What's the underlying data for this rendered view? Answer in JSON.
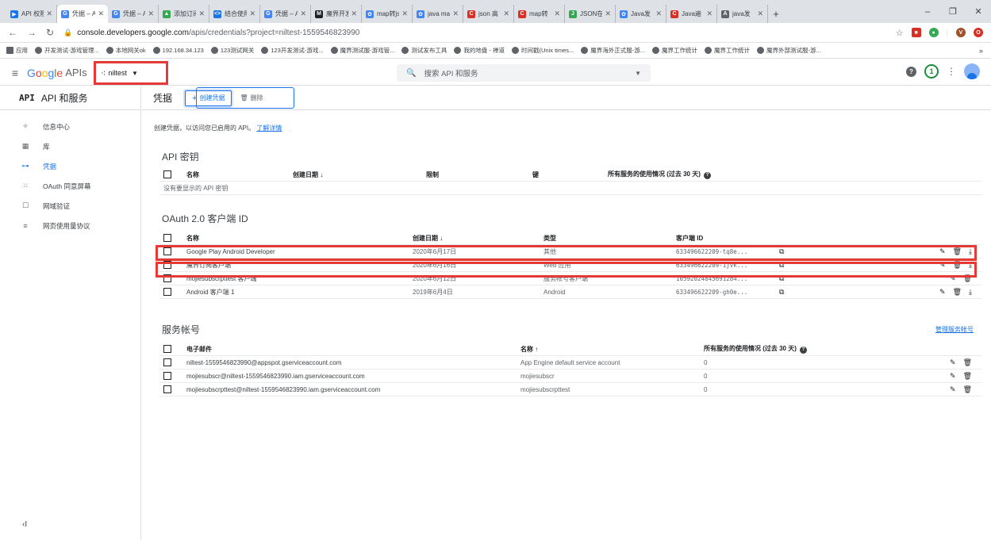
{
  "browser": {
    "tabs": [
      {
        "title": "API 权限",
        "color": "#1a73e8",
        "glyph": "▶"
      },
      {
        "title": "凭据 – A",
        "color": "#4285f4",
        "glyph": "G",
        "active": true
      },
      {
        "title": "凭据 – A",
        "color": "#4285f4",
        "glyph": "G"
      },
      {
        "title": "添加订阅",
        "color": "#34a853",
        "glyph": "▲"
      },
      {
        "title": "结合使用",
        "color": "#1a73e8",
        "glyph": "<>"
      },
      {
        "title": "凭据 – A",
        "color": "#4285f4",
        "glyph": "G"
      },
      {
        "title": "魔界开发",
        "color": "#202124",
        "glyph": "M"
      },
      {
        "title": "map转js",
        "color": "#4285f4",
        "glyph": "✿"
      },
      {
        "title": "java ma",
        "color": "#4285f4",
        "glyph": "✿"
      },
      {
        "title": "json 高",
        "color": "#d93025",
        "glyph": "C"
      },
      {
        "title": "map转",
        "color": "#d93025",
        "glyph": "C"
      },
      {
        "title": "JSON在",
        "color": "#34a853",
        "glyph": "J"
      },
      {
        "title": "Java发",
        "color": "#4285f4",
        "glyph": "✿"
      },
      {
        "title": "Java遍",
        "color": "#d93025",
        "glyph": "C"
      },
      {
        "title": "java发",
        "color": "#5f6368",
        "glyph": "A"
      }
    ],
    "new_tab": "+",
    "window_controls": {
      "minimize": "–",
      "maximize": "❐",
      "close": "✕"
    },
    "url": {
      "host": "console.developers.google.com",
      "path": "/apis/credentials?project=niltest-1559546823990"
    },
    "bookmarks": [
      {
        "label": "应用"
      },
      {
        "label": "开发测试-游戏管理..."
      },
      {
        "label": "本地网关ok"
      },
      {
        "label": "192.168.34.123"
      },
      {
        "label": "123测试网关"
      },
      {
        "label": "123开发测试-游戏..."
      },
      {
        "label": "魔界测试服-游戏管..."
      },
      {
        "label": "测试发布工具"
      },
      {
        "label": "我的地盘 - 禅道"
      },
      {
        "label": "时间戳(Unix times..."
      },
      {
        "label": "魔界海外正式服-游..."
      },
      {
        "label": "魔界工作统计"
      },
      {
        "label": "魔界工作统计"
      },
      {
        "label": "魔界外部测试服-游..."
      }
    ],
    "bookmarks_more": "»"
  },
  "header": {
    "logo_parts": [
      "G",
      "o",
      "o",
      "g",
      "l",
      "e"
    ],
    "logo_apis": "APIs",
    "project": "niltest",
    "search_placeholder": "搜索 API 和服务",
    "notifications": "1"
  },
  "sidebar": {
    "title_code": "API",
    "title": "API 和服务",
    "items": [
      {
        "label": "信息中心",
        "icon": "✧"
      },
      {
        "label": "库",
        "icon": "▦"
      },
      {
        "label": "凭据",
        "icon": "⊶",
        "active": true
      },
      {
        "label": "OAuth 同意屏幕",
        "icon": "⁙"
      },
      {
        "label": "网域验证",
        "icon": "☐"
      },
      {
        "label": "网页使用量协议",
        "icon": "≡"
      }
    ],
    "collapse": "‹I"
  },
  "main": {
    "title": "凭据",
    "create_btn": "创建凭据",
    "delete_btn": "删除",
    "intro": "创建凭据，以访问您已启用的 API。",
    "learn_more": "了解详情",
    "api_keys": {
      "title": "API 密钥",
      "headers": [
        "名称",
        "创建日期 ↓",
        "限制",
        "键",
        "所有服务的使用情况 (过去 30 天)"
      ],
      "empty": "没有要显示的 API 密钥"
    },
    "oauth": {
      "title": "OAuth 2.0 客户端 ID",
      "headers": [
        "名称",
        "创建日期 ↓",
        "类型",
        "客户端 ID"
      ],
      "rows": [
        {
          "name": "Google Play Android Developer",
          "date": "2020年6月17日",
          "type": "其他",
          "client_id": "633496622209-tq8e..."
        },
        {
          "name": "魔界订阅客户端",
          "date": "2020年6月16日",
          "type": "Web 应用",
          "client_id": "633496622209-1jvk..."
        },
        {
          "name": "mojiesubscrpttest 客户端",
          "date": "2020年6月12日",
          "type": "服务帐号客户端",
          "client_id": "10592024845691284..."
        },
        {
          "name": "Android 客户端 1",
          "date": "2019年6月4日",
          "type": "Android",
          "client_id": "633496622209-gh0e..."
        }
      ]
    },
    "service": {
      "title": "服务帐号",
      "manage": "管理服务帐号",
      "headers": [
        "电子邮件",
        "名称 ↑",
        "所有服务的使用情况 (过去 30 天)"
      ],
      "rows": [
        {
          "email": "niltest-1559546823990@appspot.gserviceaccount.com",
          "name": "App Engine default service account",
          "usage": "0"
        },
        {
          "email": "mojiesubscr@niltest-1559546823990.iam.gserviceaccount.com",
          "name": "mojiesubscr",
          "usage": "0"
        },
        {
          "email": "mojiesubscrpttest@niltest-1559546823990.iam.gserviceaccount.com",
          "name": "mojiesubscrpttest",
          "usage": "0"
        }
      ]
    }
  }
}
